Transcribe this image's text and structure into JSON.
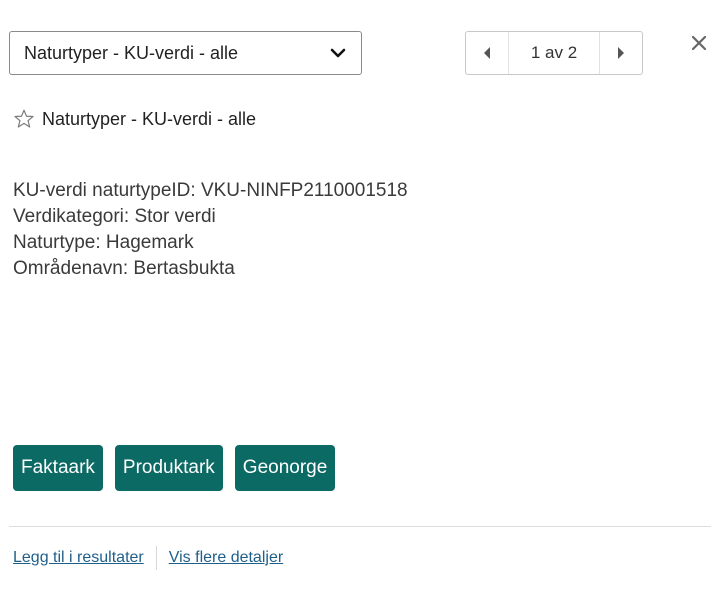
{
  "layer_select": {
    "selected": "Naturtyper - KU-verdi - alle"
  },
  "pager": {
    "count_text": "1 av 2"
  },
  "feature": {
    "title": "Naturtyper - KU-verdi - alle",
    "attributes": [
      "KU-verdi naturtypeID: VKU-NINFP2110001518",
      "Verdikategori: Stor verdi",
      "Naturtype: Hagemark",
      "Områdenavn: Bertasbukta"
    ]
  },
  "actions": {
    "buttons": [
      "Faktaark",
      "Produktark",
      "Geonorge"
    ]
  },
  "footer": {
    "add_to_results": "Legg til i resultater",
    "show_details": "Vis flere detaljer"
  },
  "colors": {
    "button_bg": "#0b6a64",
    "link": "#1f5f8b"
  }
}
